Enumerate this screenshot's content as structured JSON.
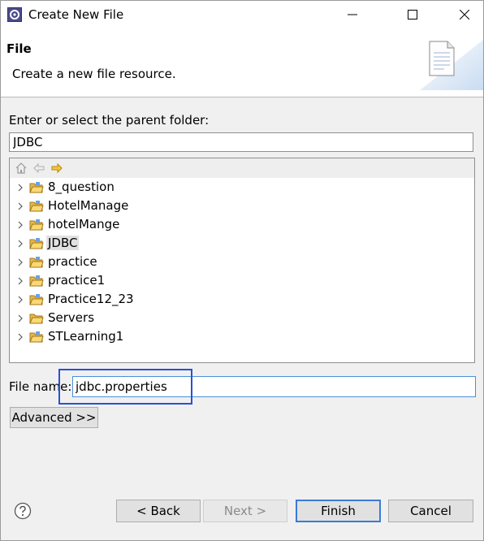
{
  "window": {
    "title": "Create New File"
  },
  "header": {
    "title": "File",
    "description": "Create a new file resource."
  },
  "parent_folder": {
    "label": "Enter or select the parent folder:",
    "value": "JDBC"
  },
  "tree": {
    "items": [
      {
        "label": "8_question"
      },
      {
        "label": "HotelManage"
      },
      {
        "label": "hotelMange"
      },
      {
        "label": "JDBC",
        "selected": true
      },
      {
        "label": "practice"
      },
      {
        "label": "practice1"
      },
      {
        "label": "Practice12_23"
      },
      {
        "label": "Servers"
      },
      {
        "label": "STLearning1"
      }
    ]
  },
  "file_name": {
    "label": "File name:",
    "value": "jdbc.properties"
  },
  "buttons": {
    "advanced": "Advanced >>",
    "back": "< Back",
    "next": "Next >",
    "finish": "Finish",
    "cancel": "Cancel"
  },
  "colors": {
    "accent": "#3c7ad4",
    "highlight_box": "#2a4fd8",
    "folder": "#e8b84a"
  },
  "icons": [
    "app-icon",
    "minimize-icon",
    "maximize-icon",
    "close-icon",
    "file-graphic-icon",
    "home-icon",
    "back-arrow-icon",
    "forward-arrow-icon",
    "chevron-right-icon",
    "folder-icon",
    "help-icon"
  ]
}
